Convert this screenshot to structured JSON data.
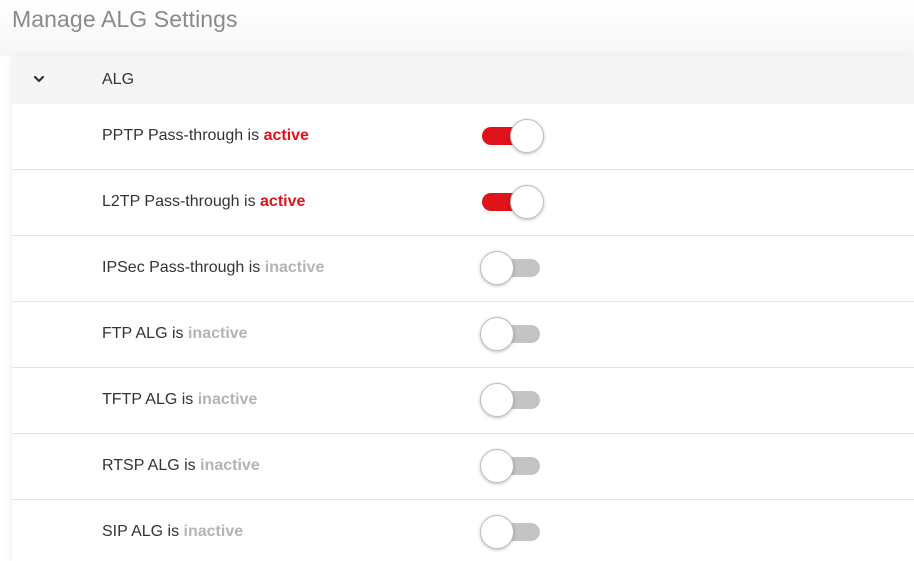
{
  "page": {
    "title": "Manage ALG Settings"
  },
  "section": {
    "title": "ALG",
    "expanded": true
  },
  "colors": {
    "active": "#e0131b",
    "inactive": "#b4b4b4",
    "toggle_on": "#e0131b",
    "toggle_off": "#c4c4c4"
  },
  "settings": [
    {
      "label": "PPTP Pass-through is",
      "status": "active",
      "enabled": true
    },
    {
      "label": "L2TP Pass-through is",
      "status": "active",
      "enabled": true
    },
    {
      "label": "IPSec Pass-through is",
      "status": "inactive",
      "enabled": false
    },
    {
      "label": "FTP ALG is",
      "status": "inactive",
      "enabled": false
    },
    {
      "label": "TFTP ALG is",
      "status": "inactive",
      "enabled": false
    },
    {
      "label": "RTSP ALG is",
      "status": "inactive",
      "enabled": false
    },
    {
      "label": "SIP ALG is",
      "status": "inactive",
      "enabled": false
    }
  ]
}
